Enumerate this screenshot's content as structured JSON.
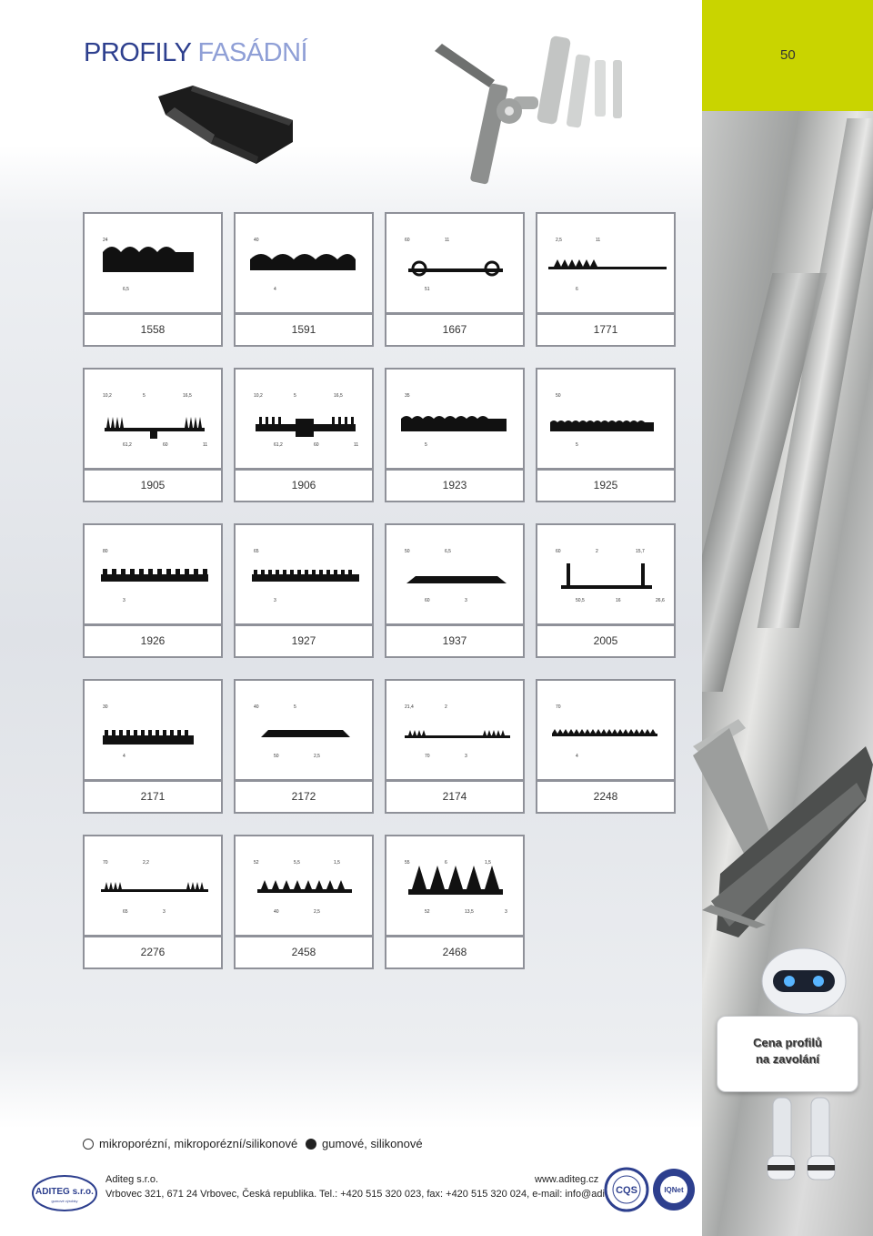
{
  "header": {
    "title_part1": "PROFILY",
    "title_part2": "FASÁDNÍ",
    "page_number": "50"
  },
  "colors": {
    "title_primary": "#2d3f8e",
    "title_secondary": "#8f9fd6",
    "accent": "#c9d400",
    "cell_border": "#8f9199"
  },
  "profiles": [
    {
      "code": "1558",
      "dims": [
        "24",
        "6,5"
      ]
    },
    {
      "code": "1591",
      "dims": [
        "40",
        "4"
      ]
    },
    {
      "code": "1667",
      "dims": [
        "60",
        "51",
        "11"
      ]
    },
    {
      "code": "1771",
      "dims": [
        "2,5",
        "6",
        "11"
      ]
    },
    {
      "code": "1905",
      "dims": [
        "10,2",
        "61,2",
        "5",
        "60",
        "16,5",
        "11"
      ]
    },
    {
      "code": "1906",
      "dims": [
        "10,2",
        "61,2",
        "5",
        "60",
        "16,5",
        "11"
      ]
    },
    {
      "code": "1923",
      "dims": [
        "35",
        "5"
      ]
    },
    {
      "code": "1925",
      "dims": [
        "50",
        "5"
      ]
    },
    {
      "code": "1926",
      "dims": [
        "80",
        "3"
      ]
    },
    {
      "code": "1927",
      "dims": [
        "65",
        "3"
      ]
    },
    {
      "code": "1937",
      "dims": [
        "50",
        "60",
        "6,5",
        "3"
      ]
    },
    {
      "code": "2005",
      "dims": [
        "60",
        "50,5",
        "2",
        "16",
        "15,7",
        "26,6",
        "15,7",
        "6"
      ]
    },
    {
      "code": "2171",
      "dims": [
        "30",
        "4"
      ]
    },
    {
      "code": "2172",
      "dims": [
        "40",
        "50",
        "5",
        "2,5"
      ]
    },
    {
      "code": "2174",
      "dims": [
        "21,4",
        "70",
        "2",
        "3"
      ]
    },
    {
      "code": "2248",
      "dims": [
        "70",
        "4"
      ]
    },
    {
      "code": "2276",
      "dims": [
        "70",
        "65",
        "2,2",
        "3"
      ]
    },
    {
      "code": "2458",
      "dims": [
        "52",
        "40",
        "5,5",
        "2,5",
        "1,5"
      ]
    },
    {
      "code": "2468",
      "dims": [
        "55",
        "52",
        "6",
        "13,5",
        "1,5",
        "3"
      ]
    }
  ],
  "sign": {
    "line1": "Cena profilů",
    "line2": "na zavolání"
  },
  "legend": {
    "open": "mikroporézní, mikroporézní/silikonové",
    "filled": "gumové, silikonové"
  },
  "footer": {
    "logo_text": "ADITEG s.r.o.",
    "logo_subtext": "gumové výrobky",
    "company": "Aditeg s.r.o.",
    "website": "www.aditeg.cz",
    "address": "Vrbovec 321, 671 24  Vrbovec, Česká republika. Tel.: +420 515 320 023, fax: +420 515 320 024, e-mail: info@aditeg.cz",
    "cert1": "CQS",
    "cert2": "IQNet"
  }
}
